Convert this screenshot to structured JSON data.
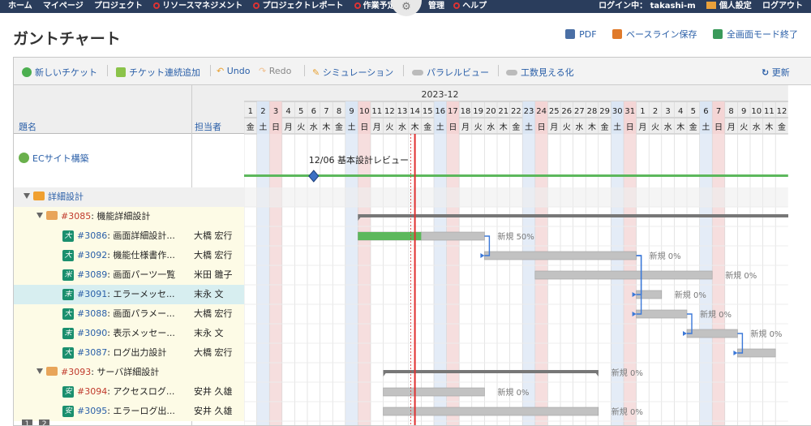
{
  "topnav": {
    "items": [
      "ホーム",
      "マイページ",
      "プロジェクト",
      "リソースマネジメント",
      "プロジェクトレポート",
      "作業予定"
    ],
    "right_items": [
      "管理",
      "ヘルプ"
    ],
    "login": "ログイン中： takashi-m",
    "settings": "個人設定",
    "logout": "ログアウト"
  },
  "page": {
    "title": "ガントチャート",
    "pdf": "PDF",
    "baseline": "ベースライン保存",
    "fullscreen": "全画面モード終了"
  },
  "toolbar": {
    "new_ticket": "新しいチケット",
    "add_continuous": "チケット連続追加",
    "undo": "Undo",
    "redo": "Redo",
    "simulation": "シミュレーション",
    "parallel_view": "パラレルビュー",
    "effort_view": "工数見える化",
    "refresh": "更新"
  },
  "columns": {
    "subject": "題名",
    "assignee": "担当者"
  },
  "rows": [
    {
      "kind": "project",
      "label": "ECサイト構築",
      "assignee": ""
    },
    {
      "kind": "version",
      "label": "詳細設計",
      "assignee": ""
    },
    {
      "kind": "parent",
      "id": "#3085",
      "label": "機能詳細設計",
      "assignee": ""
    },
    {
      "kind": "task",
      "badge": "大",
      "id": "#3086",
      "label": "画面詳細設計...",
      "assignee": "大橋 宏行"
    },
    {
      "kind": "task",
      "badge": "大",
      "id": "#3092",
      "label": "機能仕様書作...",
      "assignee": "大橋 宏行"
    },
    {
      "kind": "task",
      "badge": "米",
      "id": "#3089",
      "label": "画面パーツ一覧",
      "assignee": "米田 雛子"
    },
    {
      "kind": "task",
      "badge": "末",
      "id": "#3091",
      "label": "エラーメッセ...",
      "assignee": "末永 文"
    },
    {
      "kind": "task",
      "badge": "大",
      "id": "#3088",
      "label": "画面パラメー...",
      "assignee": "大橋 宏行"
    },
    {
      "kind": "task",
      "badge": "末",
      "id": "#3090",
      "label": "表示メッセー...",
      "assignee": "末永 文"
    },
    {
      "kind": "task",
      "badge": "大",
      "id": "#3087",
      "label": "ログ出力設計",
      "assignee": "大橋 宏行"
    },
    {
      "kind": "parent",
      "id": "#3093",
      "label": "サーバ詳細設計",
      "assignee": ""
    },
    {
      "kind": "task",
      "badge": "安",
      "id": "#3094",
      "label": "アクセスログ...",
      "assignee": "安井 久雄"
    },
    {
      "kind": "task",
      "badge": "安",
      "id": "#3095",
      "label": "エラーログ出...",
      "assignee": "安井 久雄"
    }
  ],
  "pager": [
    "1",
    "2"
  ],
  "chart_data": {
    "type": "table",
    "month_label": "2023-12",
    "start_date": "2023-12-01",
    "days": [
      1,
      2,
      3,
      4,
      5,
      6,
      7,
      8,
      9,
      10,
      11,
      12,
      13,
      14,
      15,
      16,
      17,
      18,
      19,
      20,
      21,
      22,
      23,
      24,
      25,
      26,
      27,
      28,
      29,
      30,
      31,
      1,
      2,
      3,
      4,
      5,
      6,
      7,
      8,
      9,
      10,
      11,
      12
    ],
    "weekdays": [
      "金",
      "土",
      "日",
      "月",
      "火",
      "水",
      "木",
      "金",
      "土",
      "日",
      "月",
      "火",
      "水",
      "木",
      "金",
      "土",
      "日",
      "月",
      "火",
      "水",
      "木",
      "金",
      "土",
      "日",
      "月",
      "火",
      "水",
      "木",
      "金",
      "土",
      "日",
      "月",
      "火",
      "水",
      "木",
      "金",
      "土",
      "日",
      "月",
      "火",
      "水",
      "木",
      "金"
    ],
    "today_day": 14,
    "milestone": {
      "day": 6,
      "label": "12/06 基本設計レビュー"
    },
    "bars": [
      {
        "row": 2,
        "start": 10,
        "end": 45,
        "color": "#777",
        "kind": "summary"
      },
      {
        "row": 3,
        "start": 10,
        "end": 19,
        "progress": 0.5,
        "label": "新規 50%"
      },
      {
        "row": 4,
        "start": 20,
        "end": 31,
        "progress": 0,
        "label": "新規 0%"
      },
      {
        "row": 5,
        "start": 24,
        "end": 37,
        "progress": 0,
        "label": "新規 0%"
      },
      {
        "row": 6,
        "start": 32,
        "end": 33,
        "progress": 0,
        "label": "新規 0%"
      },
      {
        "row": 7,
        "start": 32,
        "end": 35,
        "progress": 0,
        "label": "新規 0%"
      },
      {
        "row": 8,
        "start": 36,
        "end": 39,
        "progress": 0,
        "label": "新規 0%"
      },
      {
        "row": 9,
        "start": 40,
        "end": 42,
        "progress": 0,
        "label": ""
      },
      {
        "row": 10,
        "start": 12,
        "end": 28,
        "color": "#777",
        "kind": "summary",
        "label": "新規 0%"
      },
      {
        "row": 11,
        "start": 12,
        "end": 19,
        "progress": 0,
        "label": "新規 0%"
      },
      {
        "row": 12,
        "start": 12,
        "end": 28,
        "progress": 0,
        "label": "新規 0%"
      }
    ]
  }
}
